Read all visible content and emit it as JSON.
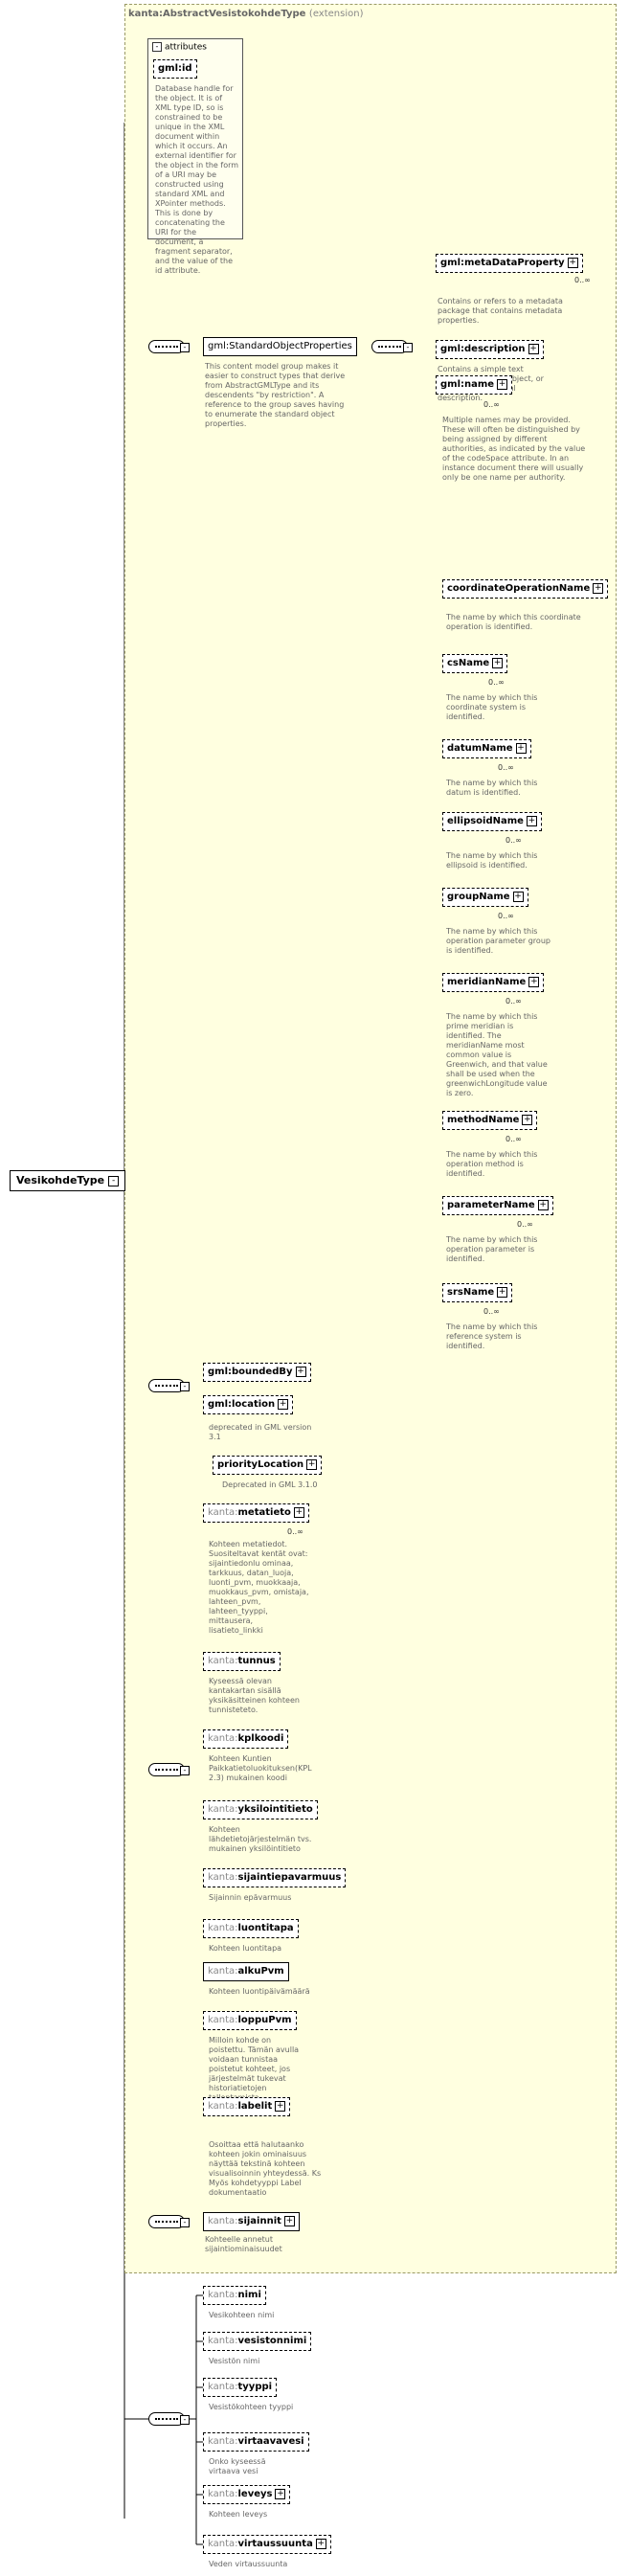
{
  "root": {
    "label": "VesikohdeType",
    "toggle": "-"
  },
  "extension": {
    "title": "kanta:AbstractVesistokohdeType",
    "subtitle": "(extension)"
  },
  "attributes": {
    "header": "attributes",
    "toggle": "-",
    "gmlid": {
      "label": "gml:id"
    },
    "gmlid_desc": "Database handle for the object.  It is of XML type ID, so is constrained to be unique in the XML document within which it occurs.  An external identifier for the object in the form of a URI may be constructed using standard XML and XPointer methods.  This is done by concatenating the URI for the document, a fragment separator, and the value of the id attribute."
  },
  "std": {
    "label": "gml:StandardObjectProperties",
    "desc": "This content model group makes it easier to construct types that derive from AbstractGMLType and its descendents \"by restriction\".  A reference to the group saves having to enumerate the standard object properties.",
    "items": [
      {
        "label": "gml:metaDataProperty",
        "card": "0..∞",
        "desc": "Contains or refers to a metadata package that contains metadata properties."
      },
      {
        "label": "gml:description",
        "card": "",
        "desc": "Contains a simple text description of the object, or refers to an external description."
      },
      {
        "label": "gml:name",
        "card": "0..∞",
        "desc": "Multiple names may be provided.  These will often be distinguished by being assigned by different authorities, as indicated by the value of the codeSpace attribute.  In an instance document there will usually only be one name per authority."
      }
    ]
  },
  "names": [
    {
      "label": "coordinateOperationName",
      "card": "",
      "desc": "The name by which this coordinate operation is identified."
    },
    {
      "label": "csName",
      "card": "0..∞",
      "desc": "The name by which this coordinate system is identified."
    },
    {
      "label": "datumName",
      "card": "0..∞",
      "desc": "The name by which this datum is identified."
    },
    {
      "label": "ellipsoidName",
      "card": "0..∞",
      "desc": "The name by which this ellipsoid is identified."
    },
    {
      "label": "groupName",
      "card": "0..∞",
      "desc": "The name by which this operation parameter group is identified."
    },
    {
      "label": "meridianName",
      "card": "0..∞",
      "desc": "The name by which this prime meridian is identified. The meridianName most common value is Greenwich, and that value shall be used when the greenwichLongitude value is zero."
    },
    {
      "label": "methodName",
      "card": "0..∞",
      "desc": "The name by which this operation method is identified."
    },
    {
      "label": "parameterName",
      "card": "0..∞",
      "desc": "The name by which this operation parameter is identified."
    },
    {
      "label": "srsName",
      "card": "0..∞",
      "desc": "The name by which this reference system is identified."
    }
  ],
  "bounded": {
    "boundedBy": {
      "label": "gml:boundedBy"
    },
    "location": {
      "label": "gml:location",
      "desc": "deprecated in GML version 3.1"
    },
    "priority": {
      "label": "priorityLocation",
      "desc": "Deprecated in GML 3.1.0"
    }
  },
  "kanta": [
    {
      "ns": "kanta:",
      "name": "metatieto",
      "card": "0..∞",
      "opt": true,
      "desc": "Kohteen metatiedot. Suositeltavat kentät ovat: sijaintiedonlu ominaa, tarkkuus, datan_luoja, luonti_pvm, muokkaaja, muokkaus_pvm, omistaja, lahteen_pvm, lahteen_tyyppi, mittausera, lisatieto_linkki"
    },
    {
      "ns": "kanta:",
      "name": "tunnus",
      "card": "",
      "opt": true,
      "desc": "Kyseessä olevan kantakartan sisällä yksikäsitteinen kohteen tunnisteteto."
    },
    {
      "ns": "kanta:",
      "name": "kplkoodi",
      "card": "",
      "opt": true,
      "desc": "Kohteen Kuntien Paikkatietoluokituksen(KPL 2.3) mukainen koodi"
    },
    {
      "ns": "kanta:",
      "name": "yksilointitieto",
      "card": "",
      "opt": true,
      "desc": "Kohteen lähdetietojärjestelmän tvs. mukainen yksilöintitieto"
    },
    {
      "ns": "kanta:",
      "name": "sijaintiepavarmuus",
      "card": "",
      "opt": true,
      "desc": "Sijainnin epävarmuus"
    },
    {
      "ns": "kanta:",
      "name": "luontitapa",
      "card": "",
      "opt": true,
      "desc": "Kohteen luontitapa"
    },
    {
      "ns": "kanta:",
      "name": "alkuPvm",
      "card": "",
      "opt": false,
      "desc": "Kohteen luontipäivämäärä"
    },
    {
      "ns": "kanta:",
      "name": "loppuPvm",
      "card": "",
      "opt": true,
      "desc": "Milloin kohde on poistettu. Tämän avulla voidaan tunnistaa poistetut kohteet, jos järjestelmät tukevat historiatietojen tallentamista"
    },
    {
      "ns": "kanta:",
      "name": "labelit",
      "card": "",
      "opt": true,
      "desc": "Osoittaa että halutaanko kohteen jokin ominaisuus näyttää tekstinä kohteen visualisoinnin yhteydessä. Ks Myös kohdetyyppi Label dokumentaatio"
    }
  ],
  "sijainnit": {
    "ns": "kanta:",
    "name": "sijainnit",
    "desc": "Kohteelle annetut sijaintiominaisuudet"
  },
  "vesi": [
    {
      "ns": "kanta:",
      "name": "nimi",
      "desc": "Vesikohteen nimi"
    },
    {
      "ns": "kanta:",
      "name": "vesistonnimi",
      "desc": "Vesistön nimi"
    },
    {
      "ns": "kanta:",
      "name": "tyyppi",
      "desc": "Vesistökohteen tyyppi"
    },
    {
      "ns": "kanta:",
      "name": "virtaavavesi",
      "desc": "Onko kyseessä virtaava vesi"
    },
    {
      "ns": "kanta:",
      "name": "leveys",
      "desc": "Kohteen leveys"
    },
    {
      "ns": "kanta:",
      "name": "virtaussuunta",
      "desc": "Veden virtaussuunta"
    }
  ]
}
